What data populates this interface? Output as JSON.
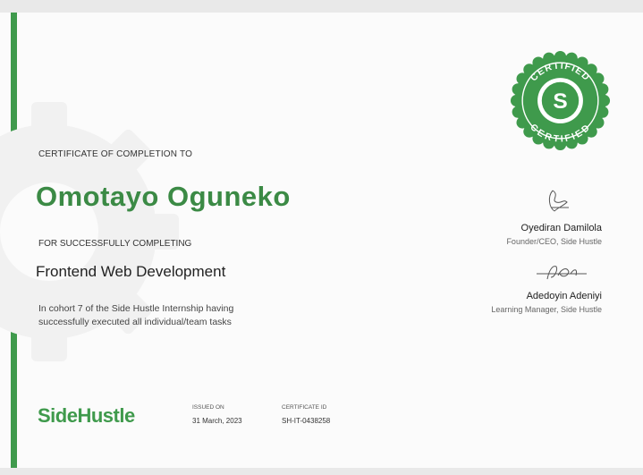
{
  "certificate": {
    "heading": "CERTIFICATE OF COMPLETION TO",
    "recipient": "Omotayo Oguneko",
    "completing_label": "FOR SUCCESSFULLY COMPLETING",
    "course": "Frontend Web Development",
    "description_lines": [
      "In cohort 7 of the Side Hustle Internship having",
      "successfully executed all individual/team tasks"
    ]
  },
  "seal": {
    "top_text": "CERTIFIED",
    "bottom_text": "CERTIFIED",
    "letter": "S",
    "color": "#3f9a4c"
  },
  "signatories": [
    {
      "name": "Oyediran Damilola",
      "role": "Founder/CEO, Side Hustle"
    },
    {
      "name": "Adedoyin Adeniyi",
      "role": "Learning Manager, Side Hustle"
    }
  ],
  "footer": {
    "logo_text": "SideHustle",
    "issued_label": "ISSUED ON",
    "issued_value": "31 March, 2023",
    "id_label": "CERTIFICATE ID",
    "id_value": "SH-IT-0438258"
  },
  "colors": {
    "accent": "#3f9a4c",
    "name_green": "#3b8a45"
  }
}
